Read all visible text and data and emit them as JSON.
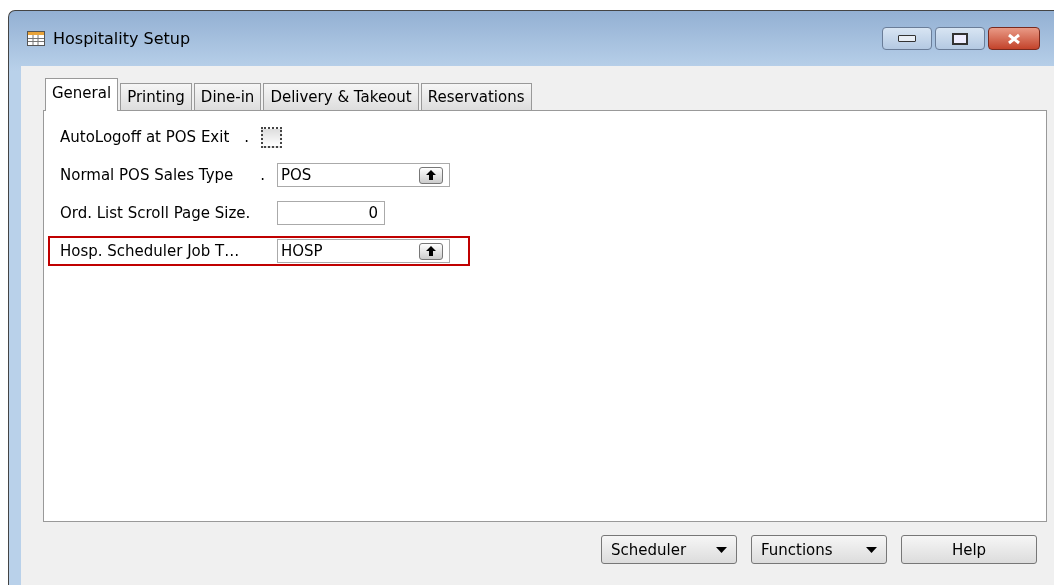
{
  "window": {
    "title": "Hospitality Setup"
  },
  "tabs": [
    {
      "label": "General",
      "selected": true
    },
    {
      "label": "Printing",
      "selected": false
    },
    {
      "label": "Dine-in",
      "selected": false
    },
    {
      "label": "Delivery & Takeout",
      "selected": false
    },
    {
      "label": "Reservations",
      "selected": false
    }
  ],
  "fields": [
    {
      "kind": "checkbox",
      "label": "AutoLogoff at POS Exit",
      "leader": ".",
      "checked": false,
      "highlighted": false
    },
    {
      "kind": "lookup",
      "label": "Normal POS Sales Type",
      "leader": ".",
      "value": "POS",
      "highlighted": false
    },
    {
      "kind": "number",
      "label": "Ord. List Scroll Page Size.",
      "value": "0",
      "highlighted": false
    },
    {
      "kind": "lookup",
      "label": "Hosp. Scheduler Job T…",
      "value": "HOSP",
      "highlighted": true
    }
  ],
  "buttons": [
    {
      "label": "Scheduler",
      "dropdown": true
    },
    {
      "label": "Functions",
      "dropdown": true
    },
    {
      "label": "Help",
      "dropdown": false
    }
  ]
}
